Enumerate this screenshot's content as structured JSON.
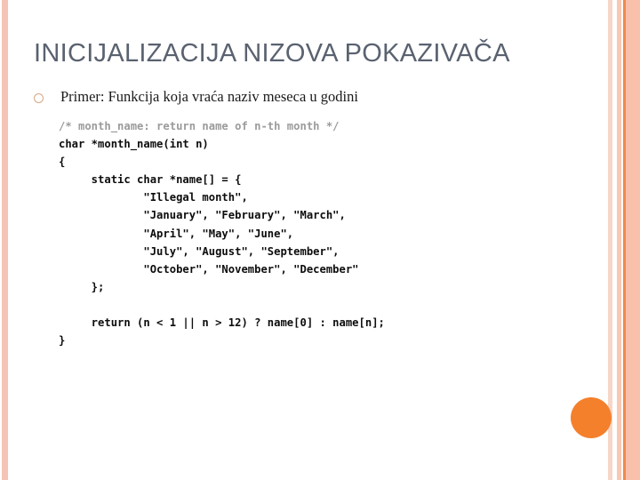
{
  "slide": {
    "title": "INICIJALIZACIJA NIZOVA POKAZIVAČA",
    "bullet": {
      "marker": "hollow-circle",
      "text": "Primer: Funkcija koja vraća naziv meseca u godini"
    },
    "code": {
      "language": "c",
      "lines": [
        {
          "kind": "comment",
          "text": "/* month_name: return name of n-th month */"
        },
        {
          "kind": "code",
          "text": "char *month_name(int n)"
        },
        {
          "kind": "code",
          "text": "{"
        },
        {
          "kind": "code",
          "text": "     static char *name[] = {"
        },
        {
          "kind": "code",
          "text": "             \"Illegal month\","
        },
        {
          "kind": "code",
          "text": "             \"January\", \"February\", \"March\","
        },
        {
          "kind": "code",
          "text": "             \"April\", \"May\", \"June\","
        },
        {
          "kind": "code",
          "text": "             \"July\", \"August\", \"September\","
        },
        {
          "kind": "code",
          "text": "             \"October\", \"November\", \"December\""
        },
        {
          "kind": "code",
          "text": "     };"
        },
        {
          "kind": "blank",
          "text": ""
        },
        {
          "kind": "code",
          "text": "     return (n < 1 || n > 12) ? name[0] : name[n];"
        },
        {
          "kind": "code",
          "text": "}"
        }
      ]
    },
    "decoration": {
      "orange_dot": "orange-dot",
      "stripe_left_color": "#f6c4b4",
      "stripe_right_light_color": "#f7d6c8",
      "stripe_right_mid_color": "#f8c8b4",
      "stripe_right_accent_color": "#ef8a4e",
      "stripe_right_wide_color": "#f9c0ac",
      "orange_dot_color": "#f4802c",
      "title_color": "#5a6270",
      "comment_color": "#9b9b9b"
    }
  }
}
